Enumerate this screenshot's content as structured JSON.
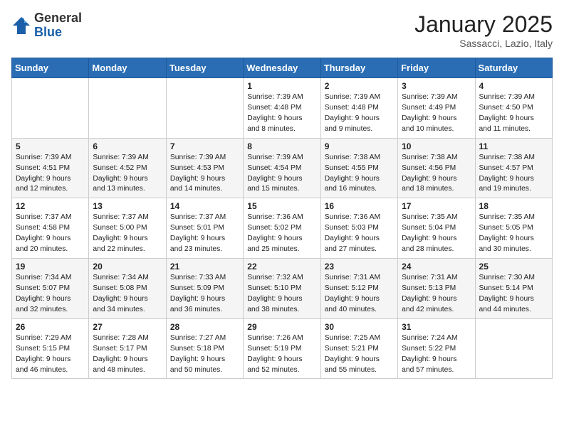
{
  "header": {
    "logo_general": "General",
    "logo_blue": "Blue",
    "month_title": "January 2025",
    "location": "Sassacci, Lazio, Italy"
  },
  "days_of_week": [
    "Sunday",
    "Monday",
    "Tuesday",
    "Wednesday",
    "Thursday",
    "Friday",
    "Saturday"
  ],
  "weeks": [
    [
      {
        "day": "",
        "info": ""
      },
      {
        "day": "",
        "info": ""
      },
      {
        "day": "",
        "info": ""
      },
      {
        "day": "1",
        "info": "Sunrise: 7:39 AM\nSunset: 4:48 PM\nDaylight: 9 hours\nand 8 minutes."
      },
      {
        "day": "2",
        "info": "Sunrise: 7:39 AM\nSunset: 4:48 PM\nDaylight: 9 hours\nand 9 minutes."
      },
      {
        "day": "3",
        "info": "Sunrise: 7:39 AM\nSunset: 4:49 PM\nDaylight: 9 hours\nand 10 minutes."
      },
      {
        "day": "4",
        "info": "Sunrise: 7:39 AM\nSunset: 4:50 PM\nDaylight: 9 hours\nand 11 minutes."
      }
    ],
    [
      {
        "day": "5",
        "info": "Sunrise: 7:39 AM\nSunset: 4:51 PM\nDaylight: 9 hours\nand 12 minutes."
      },
      {
        "day": "6",
        "info": "Sunrise: 7:39 AM\nSunset: 4:52 PM\nDaylight: 9 hours\nand 13 minutes."
      },
      {
        "day": "7",
        "info": "Sunrise: 7:39 AM\nSunset: 4:53 PM\nDaylight: 9 hours\nand 14 minutes."
      },
      {
        "day": "8",
        "info": "Sunrise: 7:39 AM\nSunset: 4:54 PM\nDaylight: 9 hours\nand 15 minutes."
      },
      {
        "day": "9",
        "info": "Sunrise: 7:38 AM\nSunset: 4:55 PM\nDaylight: 9 hours\nand 16 minutes."
      },
      {
        "day": "10",
        "info": "Sunrise: 7:38 AM\nSunset: 4:56 PM\nDaylight: 9 hours\nand 18 minutes."
      },
      {
        "day": "11",
        "info": "Sunrise: 7:38 AM\nSunset: 4:57 PM\nDaylight: 9 hours\nand 19 minutes."
      }
    ],
    [
      {
        "day": "12",
        "info": "Sunrise: 7:37 AM\nSunset: 4:58 PM\nDaylight: 9 hours\nand 20 minutes."
      },
      {
        "day": "13",
        "info": "Sunrise: 7:37 AM\nSunset: 5:00 PM\nDaylight: 9 hours\nand 22 minutes."
      },
      {
        "day": "14",
        "info": "Sunrise: 7:37 AM\nSunset: 5:01 PM\nDaylight: 9 hours\nand 23 minutes."
      },
      {
        "day": "15",
        "info": "Sunrise: 7:36 AM\nSunset: 5:02 PM\nDaylight: 9 hours\nand 25 minutes."
      },
      {
        "day": "16",
        "info": "Sunrise: 7:36 AM\nSunset: 5:03 PM\nDaylight: 9 hours\nand 27 minutes."
      },
      {
        "day": "17",
        "info": "Sunrise: 7:35 AM\nSunset: 5:04 PM\nDaylight: 9 hours\nand 28 minutes."
      },
      {
        "day": "18",
        "info": "Sunrise: 7:35 AM\nSunset: 5:05 PM\nDaylight: 9 hours\nand 30 minutes."
      }
    ],
    [
      {
        "day": "19",
        "info": "Sunrise: 7:34 AM\nSunset: 5:07 PM\nDaylight: 9 hours\nand 32 minutes."
      },
      {
        "day": "20",
        "info": "Sunrise: 7:34 AM\nSunset: 5:08 PM\nDaylight: 9 hours\nand 34 minutes."
      },
      {
        "day": "21",
        "info": "Sunrise: 7:33 AM\nSunset: 5:09 PM\nDaylight: 9 hours\nand 36 minutes."
      },
      {
        "day": "22",
        "info": "Sunrise: 7:32 AM\nSunset: 5:10 PM\nDaylight: 9 hours\nand 38 minutes."
      },
      {
        "day": "23",
        "info": "Sunrise: 7:31 AM\nSunset: 5:12 PM\nDaylight: 9 hours\nand 40 minutes."
      },
      {
        "day": "24",
        "info": "Sunrise: 7:31 AM\nSunset: 5:13 PM\nDaylight: 9 hours\nand 42 minutes."
      },
      {
        "day": "25",
        "info": "Sunrise: 7:30 AM\nSunset: 5:14 PM\nDaylight: 9 hours\nand 44 minutes."
      }
    ],
    [
      {
        "day": "26",
        "info": "Sunrise: 7:29 AM\nSunset: 5:15 PM\nDaylight: 9 hours\nand 46 minutes."
      },
      {
        "day": "27",
        "info": "Sunrise: 7:28 AM\nSunset: 5:17 PM\nDaylight: 9 hours\nand 48 minutes."
      },
      {
        "day": "28",
        "info": "Sunrise: 7:27 AM\nSunset: 5:18 PM\nDaylight: 9 hours\nand 50 minutes."
      },
      {
        "day": "29",
        "info": "Sunrise: 7:26 AM\nSunset: 5:19 PM\nDaylight: 9 hours\nand 52 minutes."
      },
      {
        "day": "30",
        "info": "Sunrise: 7:25 AM\nSunset: 5:21 PM\nDaylight: 9 hours\nand 55 minutes."
      },
      {
        "day": "31",
        "info": "Sunrise: 7:24 AM\nSunset: 5:22 PM\nDaylight: 9 hours\nand 57 minutes."
      },
      {
        "day": "",
        "info": ""
      }
    ]
  ]
}
